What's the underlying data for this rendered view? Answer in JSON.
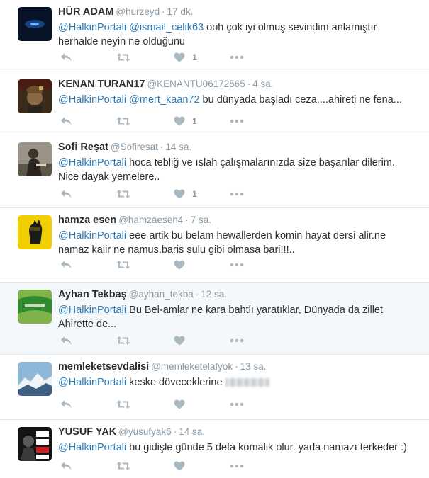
{
  "colors": {
    "mention": "#2b7bb9",
    "meta": "#8899a6",
    "text": "#292f33",
    "icon": "#aab8c2",
    "highlight_row": "#f5f8fa"
  },
  "icons": {
    "reply": "reply-icon",
    "retweet": "retweet-icon",
    "like": "heart-icon",
    "more": "more-icon"
  },
  "tweets": [
    {
      "name": "HÜR ADAM",
      "handle": "@hurzeyd",
      "sep": "·",
      "time": "17 dk.",
      "mentions": [
        "@HalkinPortali",
        "@ismail_celik63"
      ],
      "text": "ooh çok iyi olmuş sevindim anlamıştır herhalde neyin ne olduğunu",
      "likes": "1"
    },
    {
      "name": "KENAN TURAN17",
      "handle": "@KENANTU06172565",
      "sep": "·",
      "time": "4 sa.",
      "mentions": [
        "@HalkinPortali",
        "@mert_kaan72"
      ],
      "text": "bu dünyada başladı ceza....ahireti ne fena...",
      "likes": "1"
    },
    {
      "name": "Sofi Reşat",
      "handle": "@Sofiresat",
      "sep": "·",
      "time": "14 sa.",
      "mentions": [
        "@HalkinPortali"
      ],
      "text": " hoca tebliğ ve ıslah çalışmalarınızda size başarılar dilerim. Nice dayak yemelere..",
      "likes": "1"
    },
    {
      "name": "hamza esen",
      "handle": "@hamzaesen4",
      "sep": "·",
      "time": "7 sa.",
      "mentions": [
        "@HalkinPortali"
      ],
      "text": "eee artik bu belam hewallerden komin hayat dersi alir.ne namaz kalir ne namus.baris sulu gibi olmasa bari!!!..",
      "likes": ""
    },
    {
      "name": "Ayhan Tekbaş",
      "handle": "@ayhan_tekba",
      "sep": "·",
      "time": "12 sa.",
      "mentions": [
        "@HalkinPortali"
      ],
      "text": "Bu Bel-amlar ne kara bahtlı yaratıklar, Dünyada da zillet Ahirette de...",
      "likes": ""
    },
    {
      "name": "memleketsevdalisi",
      "handle": "@memleketelafyok",
      "sep": "·",
      "time": "13 sa.",
      "mentions": [
        "@HalkinPortali"
      ],
      "text": " keske döveceklerine",
      "likes": ""
    },
    {
      "name": "YUSUF YAK",
      "handle": "@yusufyak6",
      "sep": "·",
      "time": "14 sa.",
      "mentions": [
        "@HalkinPortali"
      ],
      "text": " bu gidişle günde 5 defa komalik olur. yada namazı terkeder :)",
      "likes": ""
    }
  ]
}
